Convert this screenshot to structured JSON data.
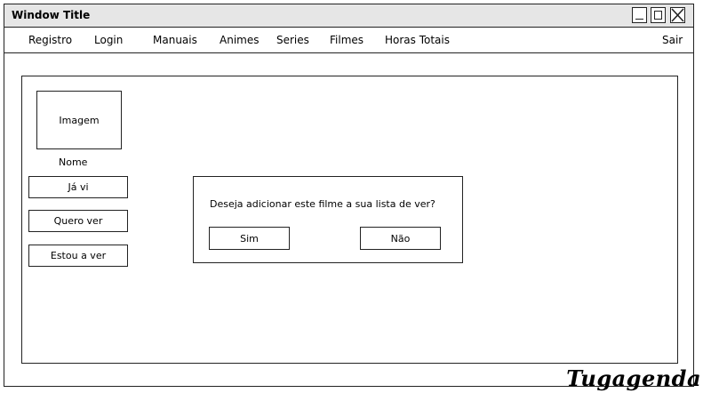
{
  "window": {
    "title": "Window Title"
  },
  "menu": {
    "items": [
      "Registro",
      "Login",
      "Manuais",
      "Animes",
      "Series",
      "Filmes",
      "Horas Totais"
    ],
    "logout": "Sair"
  },
  "item_card": {
    "image_placeholder": "Imagem",
    "name": "Nome",
    "buttons": [
      "Já vi",
      "Quero ver",
      "Estou a ver"
    ]
  },
  "dialog": {
    "message": "Deseja adicionar este filme a sua lista de ver?",
    "yes": "Sim",
    "no": "Não"
  },
  "brand": "Tugagenda"
}
